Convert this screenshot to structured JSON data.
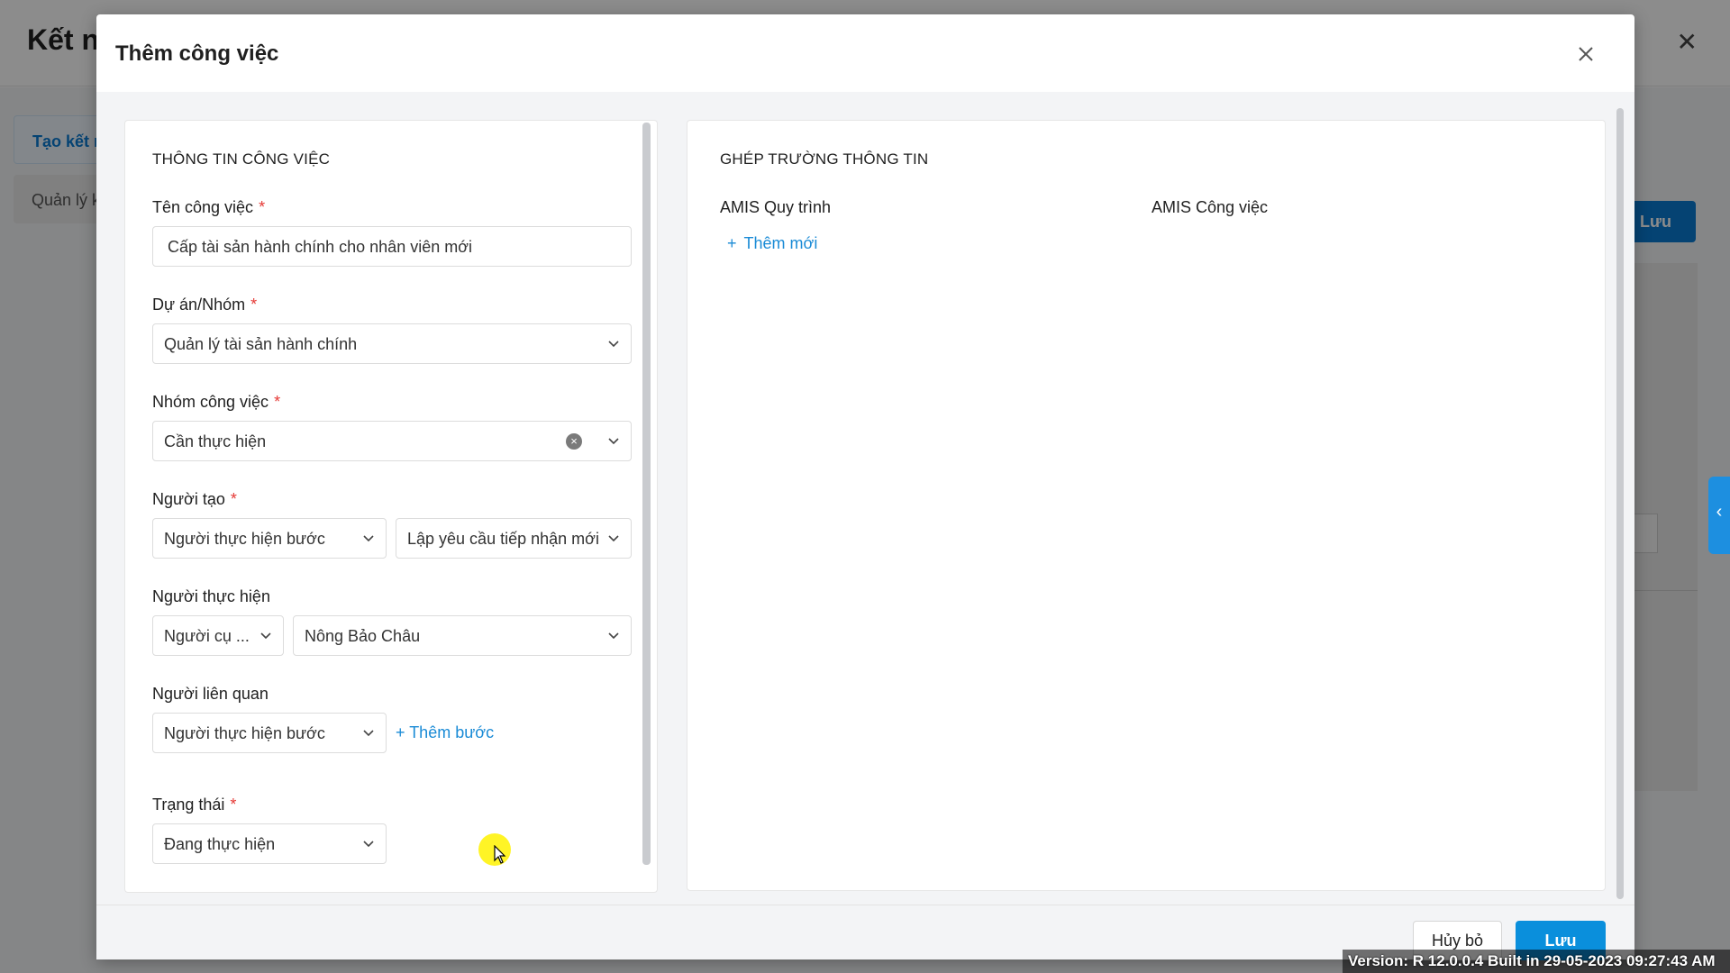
{
  "background": {
    "page_title": "Kết n",
    "tab_create": "Tạo kết n",
    "tab_manage": "Quản lý k",
    "save_label": "Lưu"
  },
  "modal": {
    "title": "Thêm công việc",
    "left": {
      "section_title": "THÔNG TIN CÔNG VIỆC",
      "task_name": {
        "label": "Tên công việc",
        "required": "*",
        "value": "Cấp tài sản hành chính cho nhân viên mới"
      },
      "project": {
        "label": "Dự án/Nhóm",
        "required": "*",
        "value": "Quản lý tài sản hành chính"
      },
      "task_group": {
        "label": "Nhóm công việc",
        "required": "*",
        "value": "Cần thực hiện"
      },
      "creator": {
        "label": "Người tạo",
        "required": "*",
        "type_value": "Người thực hiện bước",
        "step_value": "Lập yêu cầu tiếp nhận mới"
      },
      "assignee": {
        "label": "Người thực hiện",
        "type_value": "Người cụ ...",
        "person_value": "Nông Bảo Châu"
      },
      "related": {
        "label": "Người liên quan",
        "type_value": "Người thực hiện bước",
        "add_step": "+ Thêm bước"
      },
      "status": {
        "label": "Trạng thái",
        "required": "*",
        "value": "Đang thực hiện"
      }
    },
    "right": {
      "section_title": "GHÉP TRƯỜNG THÔNG TIN",
      "col_process": "AMIS Quy trình",
      "col_task": "AMIS Công việc",
      "add_new": "Thêm mới"
    },
    "footer": {
      "cancel_label": "Hủy bỏ",
      "save_label": "Lưu"
    }
  },
  "version_text": "Version: R 12.0.0.4 Built in 29-05-2023 09:27:43 AM",
  "colors": {
    "primary": "#0a8fdc",
    "link": "#1a8bd6",
    "required": "#e53935"
  }
}
